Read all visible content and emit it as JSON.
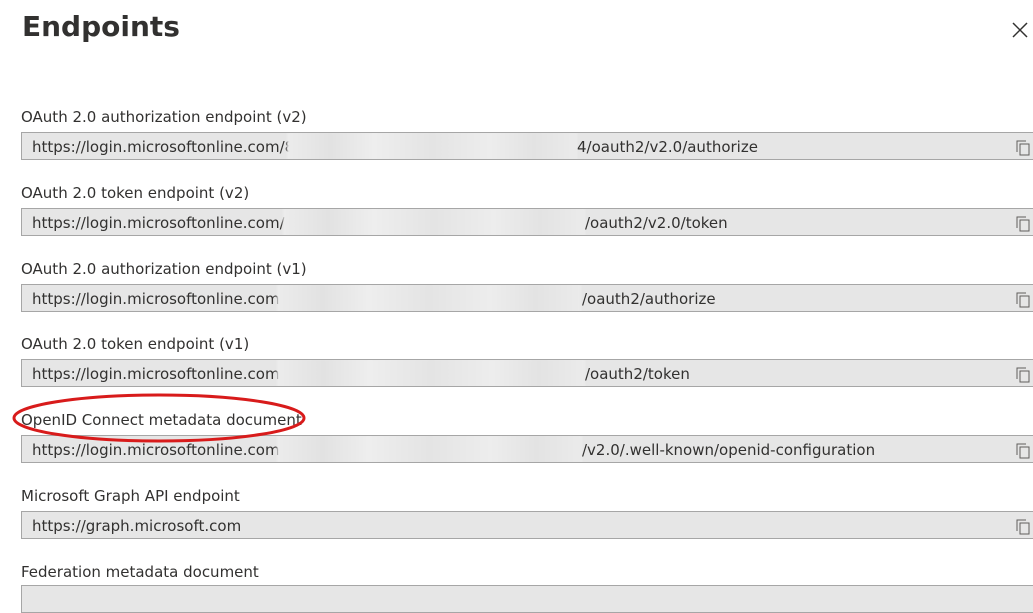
{
  "panel": {
    "title": "Endpoints",
    "close_icon": "close-icon",
    "copy_icon": "copy-icon",
    "highlight_color": "#d81b1b",
    "field_background": "#e6e6e6"
  },
  "fields": [
    {
      "label": "OAuth 2.0 authorization endpoint (v2)",
      "prefix": "https://login.microsoftonline.com/8",
      "suffix": "4/oauth2/v2.0/authorize"
    },
    {
      "label": "OAuth 2.0 token endpoint (v2)",
      "prefix": "https://login.microsoftonline.com/8",
      "suffix": "/oauth2/v2.0/token"
    },
    {
      "label": "OAuth 2.0 authorization endpoint (v1)",
      "prefix": "https://login.microsoftonline.com/",
      "suffix": "/oauth2/authorize"
    },
    {
      "label": "OAuth 2.0 token endpoint (v1)",
      "prefix": "https://login.microsoftonline.com/",
      "suffix": "/oauth2/token"
    },
    {
      "label": "OpenID Connect metadata document",
      "prefix": "https://login.microsoftonline.com/",
      "suffix": "/v2.0/.well-known/openid-configuration"
    },
    {
      "label": "Microsoft Graph API endpoint",
      "prefix": "https://graph.microsoft.com",
      "suffix": ""
    },
    {
      "label": "Federation metadata document",
      "prefix": "",
      "suffix": ""
    }
  ]
}
